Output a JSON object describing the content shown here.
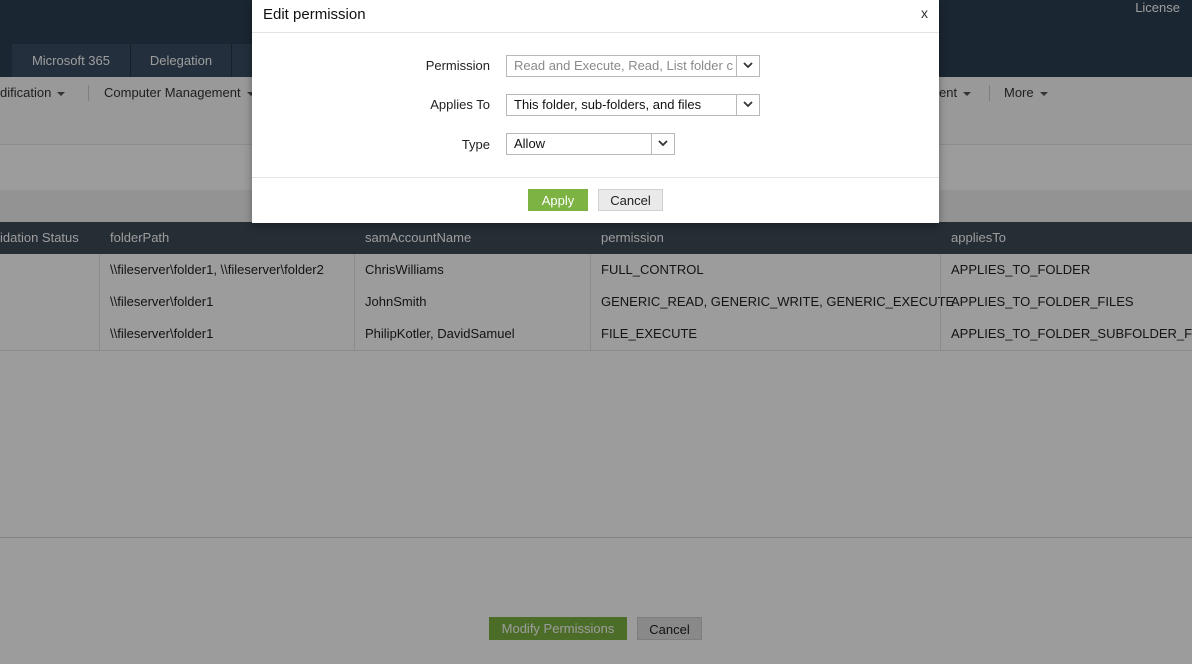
{
  "header": {
    "license_label": "License"
  },
  "tabs": [
    {
      "label": "Microsoft 365"
    },
    {
      "label": "Delegation"
    }
  ],
  "submenu": [
    {
      "label": "dification"
    },
    {
      "label": "Computer Management"
    },
    {
      "label": "ent"
    },
    {
      "label": "More"
    }
  ],
  "table": {
    "columns": [
      "idation Status",
      "folderPath",
      "samAccountName",
      "permission",
      "appliesTo"
    ],
    "rows": [
      {
        "status": "",
        "folderPath": "\\\\fileserver\\folder1, \\\\fileserver\\folder2",
        "samAccountName": "ChrisWilliams",
        "permission": "FULL_CONTROL",
        "appliesTo": "APPLIES_TO_FOLDER"
      },
      {
        "status": "",
        "folderPath": "\\\\fileserver\\folder1",
        "samAccountName": "JohnSmith",
        "permission": "GENERIC_READ, GENERIC_WRITE, GENERIC_EXECUTE",
        "appliesTo": "APPLIES_TO_FOLDER_FILES"
      },
      {
        "status": "",
        "folderPath": "\\\\fileserver\\folder1",
        "samAccountName": "PhilipKotler, DavidSamuel",
        "permission": "FILE_EXECUTE",
        "appliesTo": "APPLIES_TO_FOLDER_SUBFOLDER_FILES"
      }
    ]
  },
  "footer": {
    "modify_label": "Modify Permissions",
    "cancel_label": "Cancel"
  },
  "modal": {
    "title": "Edit permission",
    "close_label": "x",
    "fields": {
      "permission": {
        "label": "Permission",
        "value": "Read and Execute, Read, List folder c"
      },
      "applies_to": {
        "label": "Applies To",
        "value": "This folder, sub-folders, and files"
      },
      "type": {
        "label": "Type",
        "value": "Allow"
      }
    },
    "apply_label": "Apply",
    "cancel_label": "Cancel"
  },
  "colors": {
    "accent": "#7cb342",
    "header": "#2c3e50",
    "table_header": "#3d4a58"
  }
}
